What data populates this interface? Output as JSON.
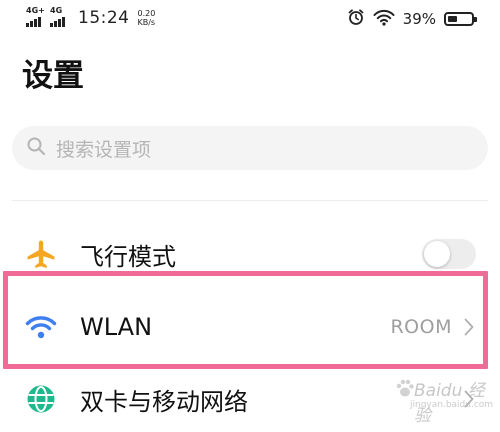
{
  "status_bar": {
    "sim1_network": "4G+",
    "sim2_network": "4G",
    "time": "15:24",
    "speed_value": "0.20",
    "speed_unit": "KB/s",
    "battery_percent": "39%",
    "battery_level": 0.39
  },
  "page": {
    "title": "设置"
  },
  "search": {
    "placeholder": "搜索设置项"
  },
  "settings": {
    "airplane": {
      "label": "飞行模式",
      "enabled": false,
      "icon": "airplane-icon",
      "icon_color": "#f5a623"
    },
    "wlan": {
      "label": "WLAN",
      "value": "ROOM",
      "icon": "wifi-icon",
      "icon_color": "#3f7ff0"
    },
    "dual_sim": {
      "label": "双卡与移动网络",
      "icon": "globe-icon",
      "icon_color": "#1fb98e"
    }
  },
  "highlight_color": "#f06b95",
  "watermark": {
    "main": "Baidu 经验",
    "sub": "jingyan.baidu.com"
  }
}
